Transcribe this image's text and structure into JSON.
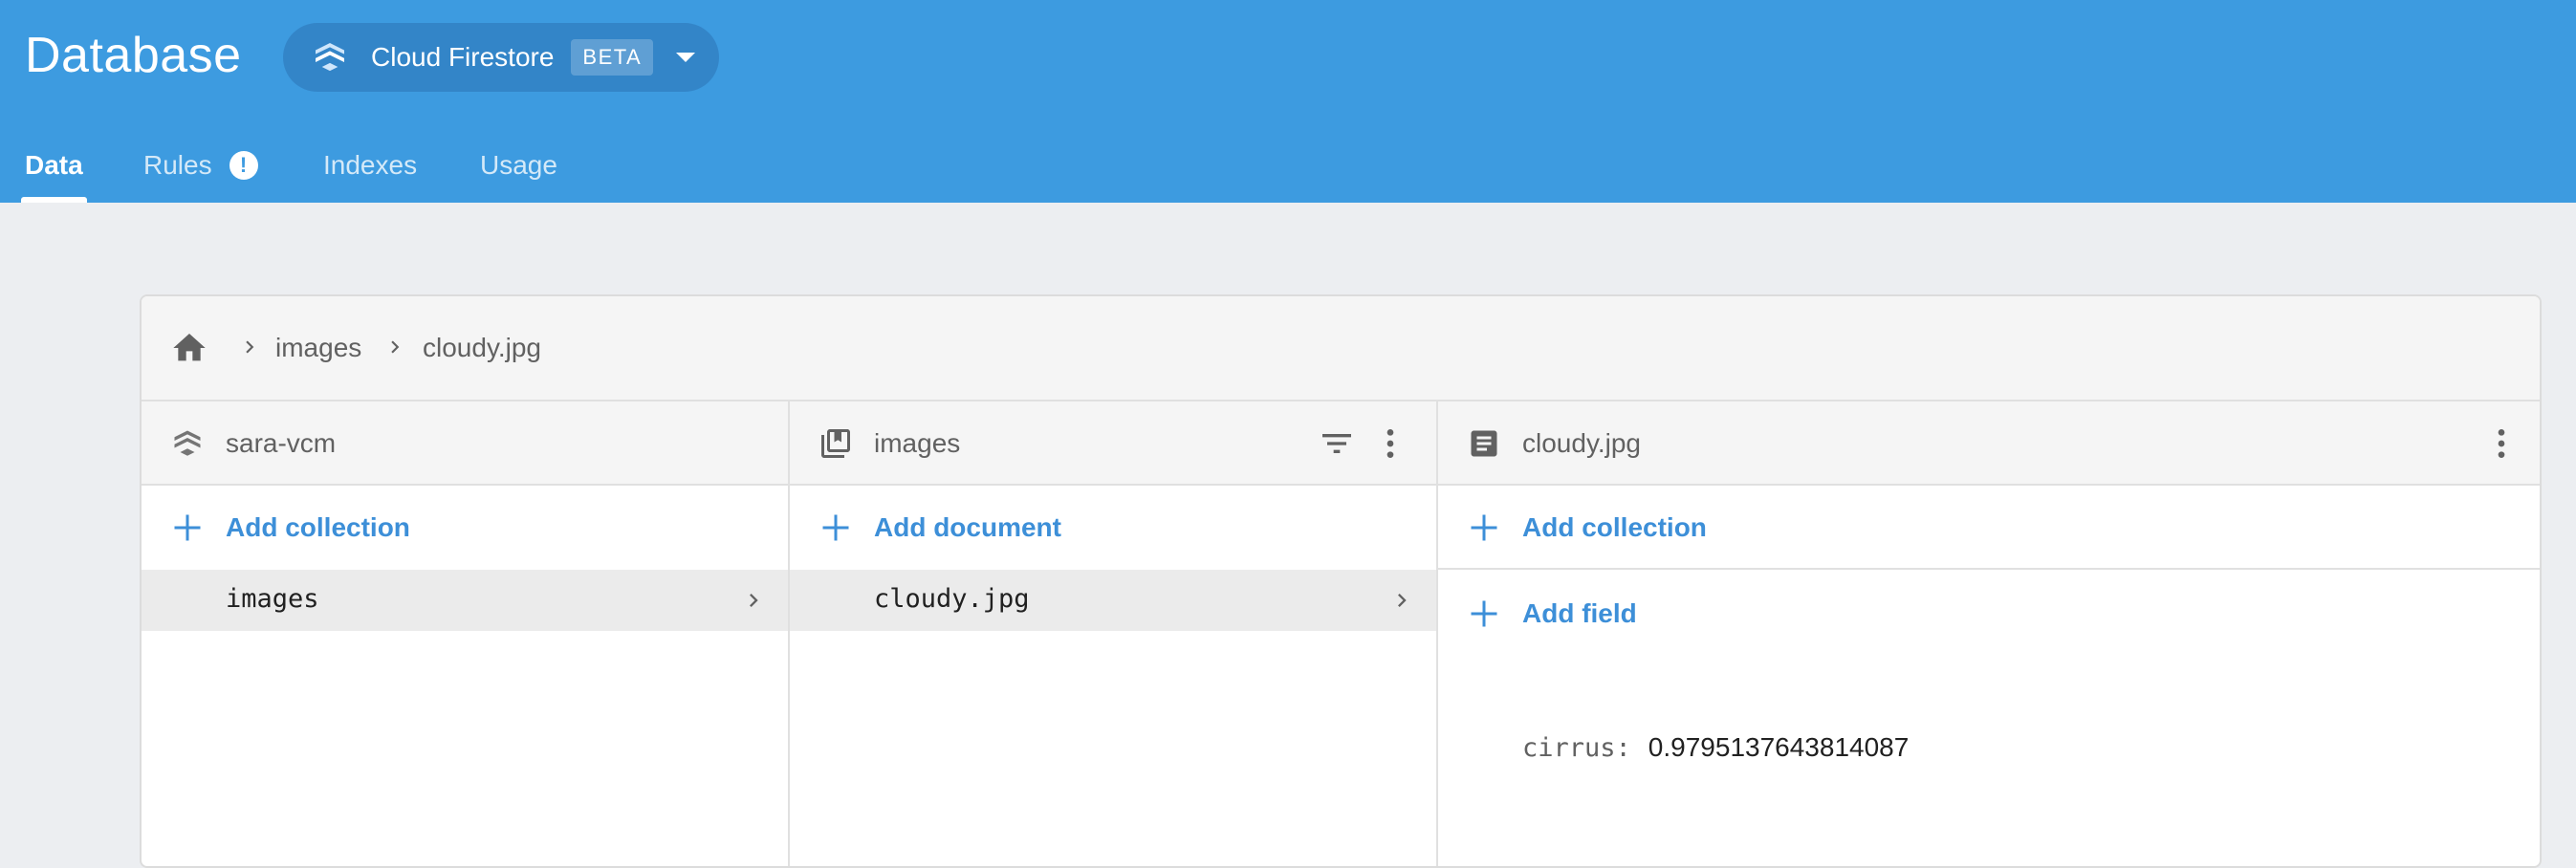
{
  "header": {
    "title": "Database",
    "database_selector": {
      "name": "Cloud Firestore",
      "badge": "BETA",
      "icon": "firestore-icon"
    },
    "tabs": [
      {
        "label": "Data",
        "active": true
      },
      {
        "label": "Rules",
        "active": false,
        "badge_icon": "warning-icon",
        "badge_text": "!"
      },
      {
        "label": "Indexes",
        "active": false
      },
      {
        "label": "Usage",
        "active": false
      }
    ],
    "colors": {
      "header_bg": "#3d9be0",
      "accent": "#3d8fd8"
    }
  },
  "breadcrumb": {
    "home_icon": "home-icon",
    "items": [
      "images",
      "cloudy.jpg"
    ]
  },
  "panels": {
    "root": {
      "title": "sara-vcm",
      "icon": "firestore-icon",
      "add_label": "Add collection",
      "items": [
        "images"
      ]
    },
    "collection": {
      "title": "images",
      "icon": "collection-icon",
      "add_label": "Add document",
      "items": [
        "cloudy.jpg"
      ]
    },
    "document": {
      "title": "cloudy.jpg",
      "icon": "document-icon",
      "add_collection_label": "Add collection",
      "add_field_label": "Add field",
      "fields": [
        {
          "key": "cirrus:",
          "value": "0.9795137643814087"
        }
      ]
    }
  }
}
